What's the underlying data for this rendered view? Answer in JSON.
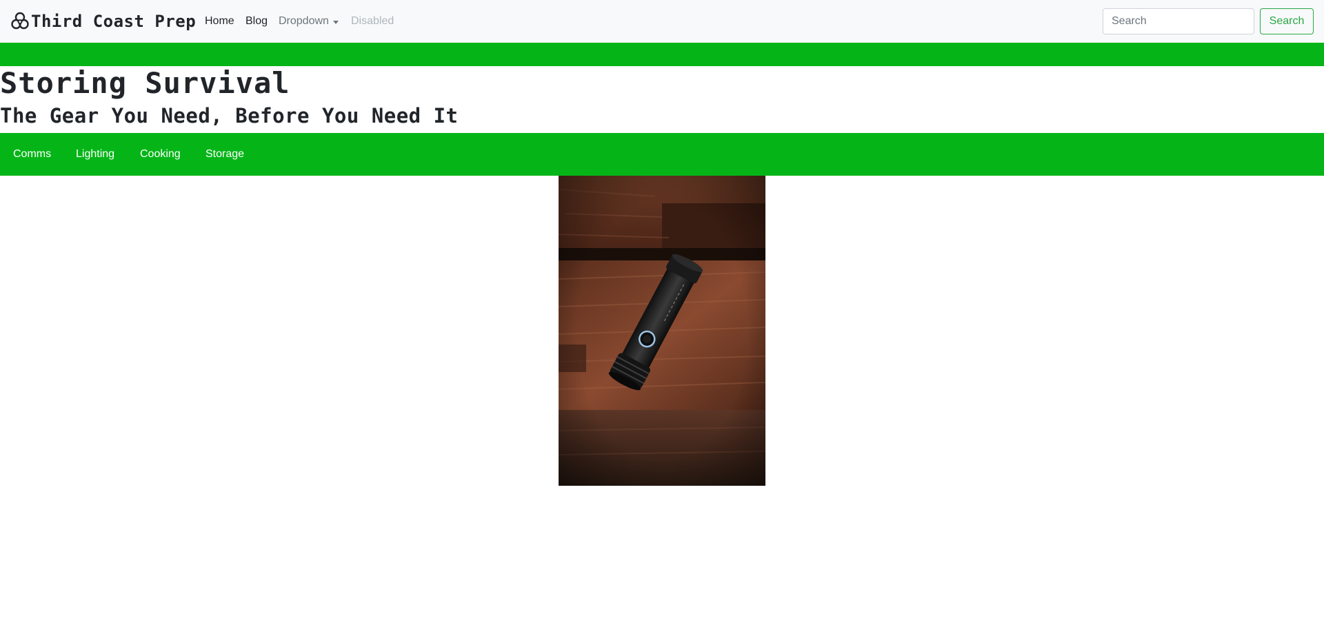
{
  "navbar": {
    "brand_text": "Third Coast Prep",
    "brand_icon": "biohazard-icon",
    "links": {
      "home": "Home",
      "blog": "Blog",
      "dropdown": "Dropdown",
      "disabled": "Disabled"
    },
    "search": {
      "placeholder": "Search",
      "value": "",
      "button_label": "Search"
    }
  },
  "hero": {
    "title": "Storing Survival",
    "subtitle": "The Gear You Need, Before You Need It"
  },
  "categories": [
    "Comms",
    "Lighting",
    "Cooking",
    "Storage"
  ],
  "colors": {
    "accent_green": "#05b518",
    "navbar_bg": "#f8f9fa",
    "button_green": "#28a745"
  },
  "product_photo": {
    "subject": "flashlight-photo"
  }
}
